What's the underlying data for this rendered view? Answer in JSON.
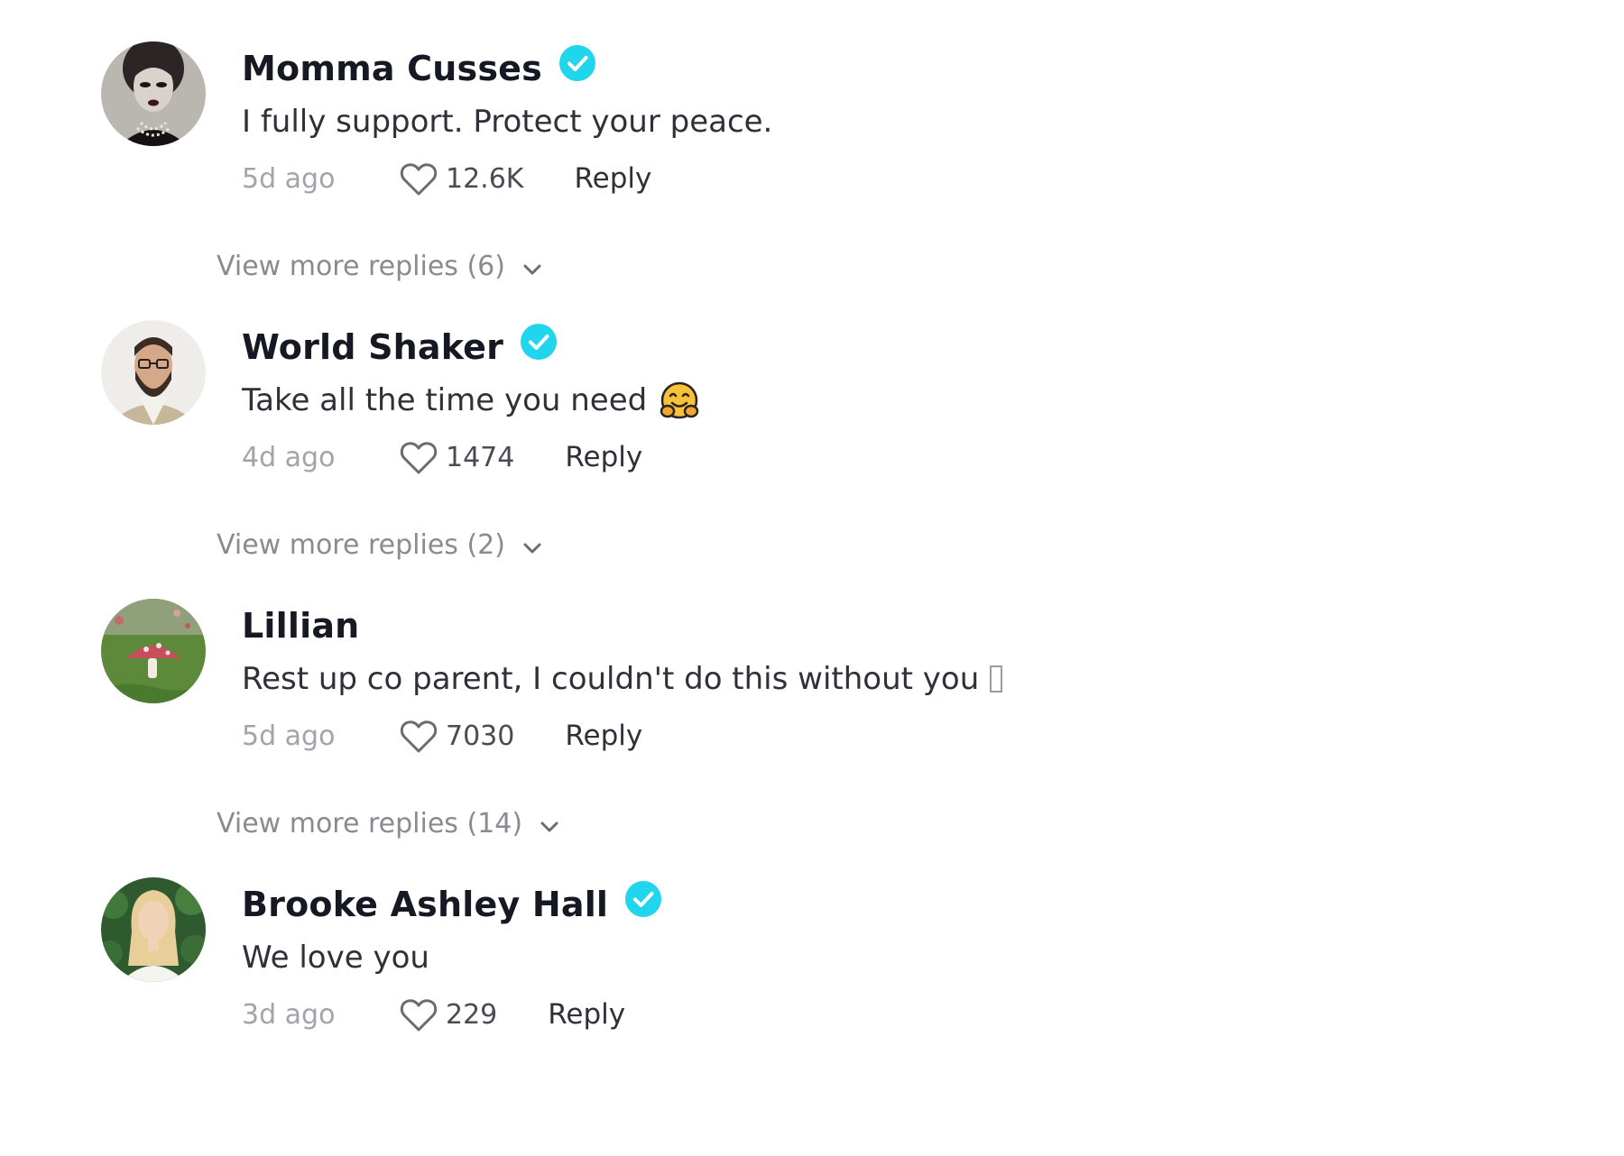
{
  "comments": [
    {
      "avatar": "avatar-dramatic-woman",
      "username": "Momma Cusses",
      "verified": true,
      "text": "I fully support. Protect your peace.",
      "time": "5d ago",
      "likes": "12.6K",
      "reply_label": "Reply",
      "view_more": "View more replies (6)"
    },
    {
      "avatar": "avatar-bearded-man",
      "username": "World Shaker",
      "verified": true,
      "text": "Take all the time you need",
      "emoji": "hugging-face-emoji",
      "time": "4d ago",
      "likes": "1474",
      "reply_label": "Reply",
      "view_more": "View more replies (2)"
    },
    {
      "avatar": "avatar-mushroom",
      "username": "Lillian",
      "verified": false,
      "text": "Rest up co parent, I couldn't do this without you",
      "trailing_glyph": "missing-character-box",
      "time": "5d ago",
      "likes": "7030",
      "reply_label": "Reply",
      "view_more": "View more replies (14)"
    },
    {
      "avatar": "avatar-blonde-woman",
      "username": "Brooke Ashley Hall",
      "verified": true,
      "text": "We love you",
      "time": "3d ago",
      "likes": "229",
      "reply_label": "Reply"
    }
  ],
  "colors": {
    "verified": "#20d5ec",
    "username": "#161823",
    "muted": "#a3a4aa"
  }
}
